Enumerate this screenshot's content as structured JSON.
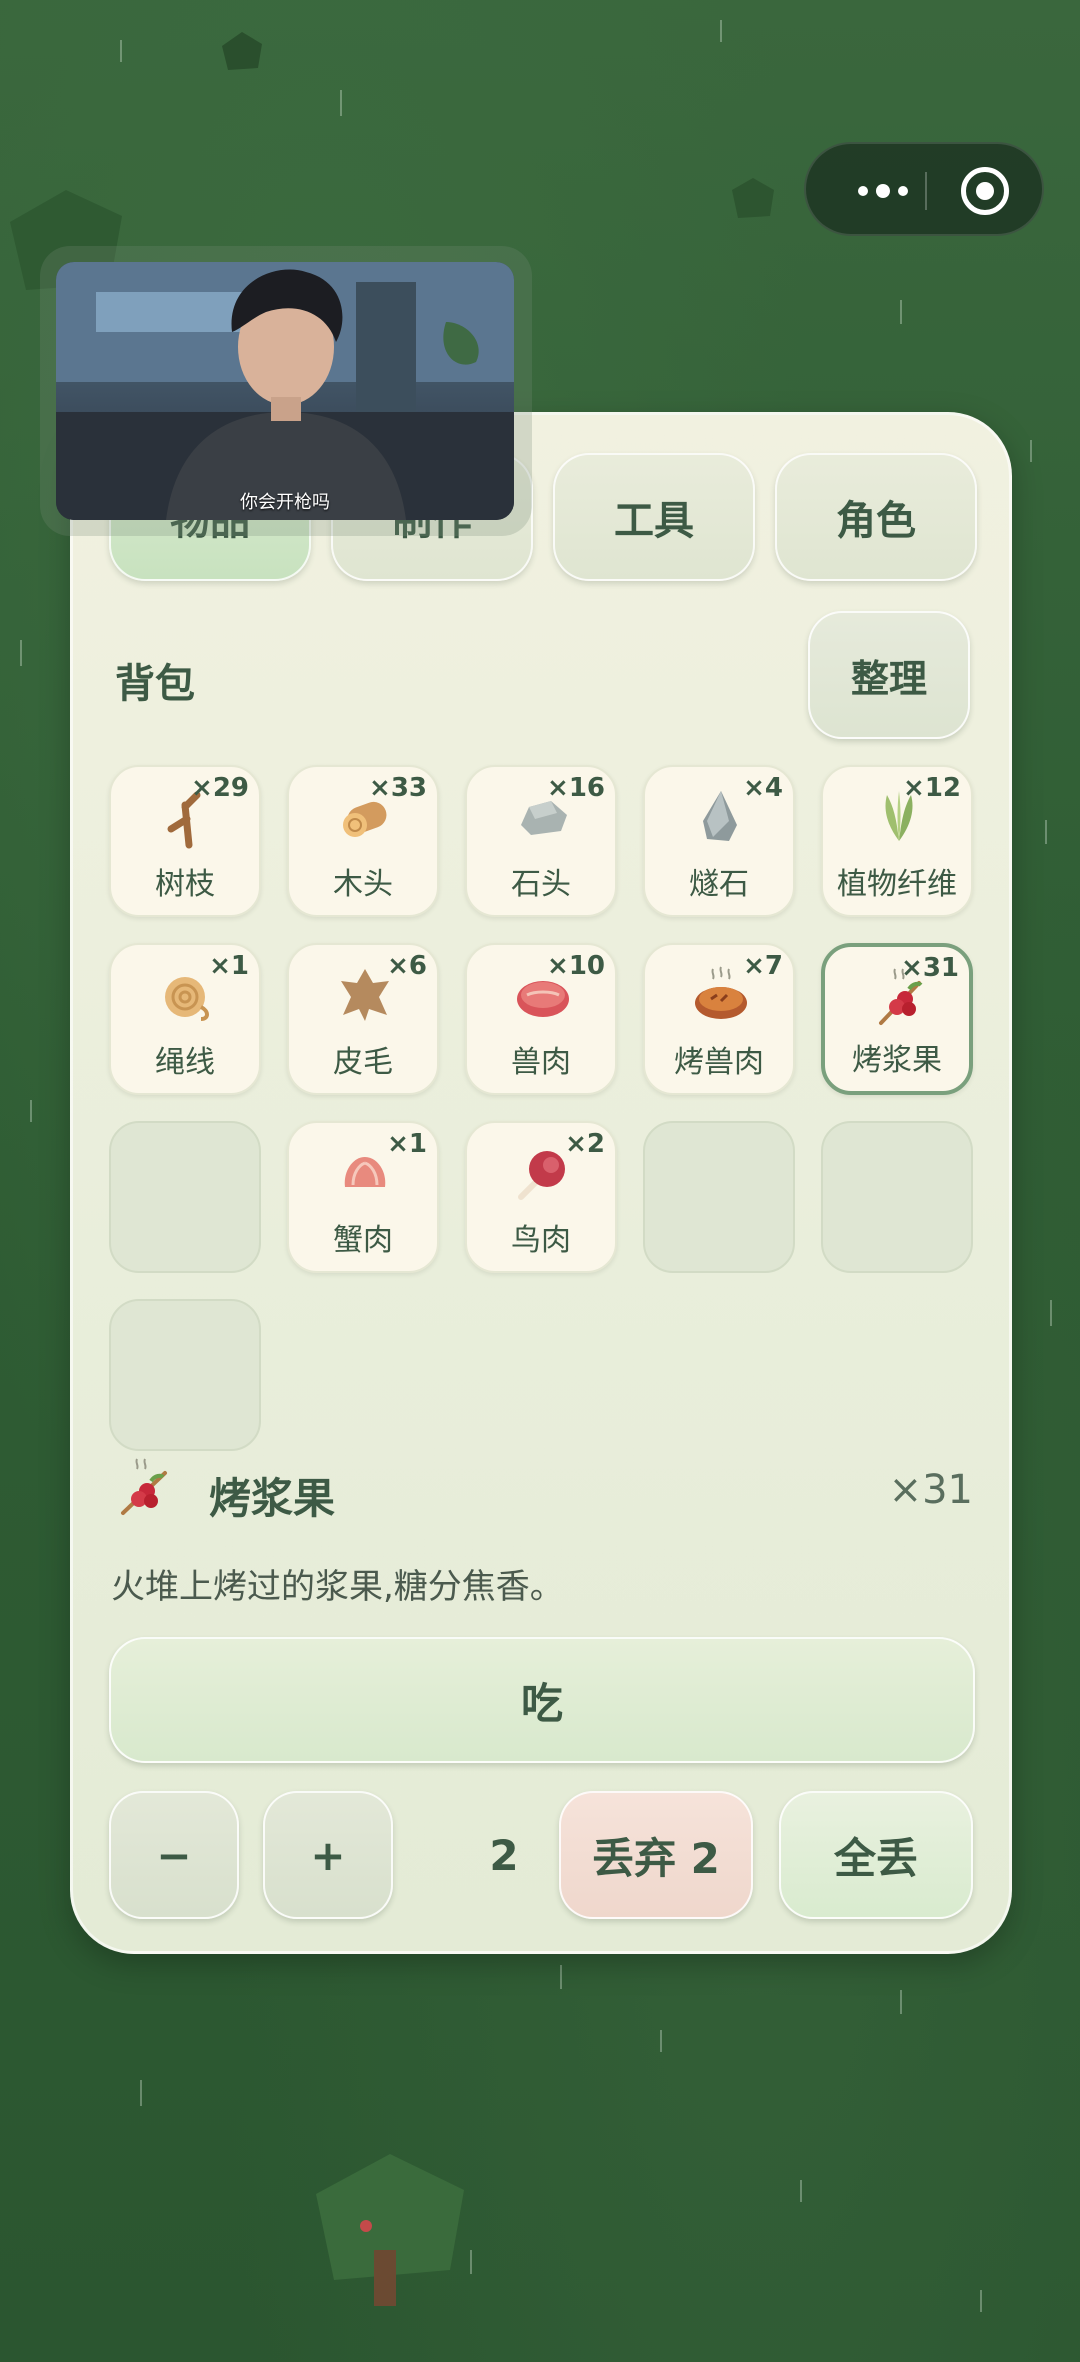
{
  "tabs": [
    {
      "label": "物品",
      "active": true
    },
    {
      "label": "制作",
      "active": false
    },
    {
      "label": "工具",
      "active": false
    },
    {
      "label": "角色",
      "active": false
    }
  ],
  "inventory": {
    "title": "背包",
    "sort_label": "整理",
    "slots": [
      {
        "name": "树枝",
        "count": "×29",
        "icon": "branch-icon"
      },
      {
        "name": "木头",
        "count": "×33",
        "icon": "log-icon"
      },
      {
        "name": "石头",
        "count": "×16",
        "icon": "stone-icon"
      },
      {
        "name": "燧石",
        "count": "×4",
        "icon": "flint-icon"
      },
      {
        "name": "植物纤维",
        "count": "×12",
        "icon": "plant-fiber-icon"
      },
      {
        "name": "绳线",
        "count": "×1",
        "icon": "rope-icon"
      },
      {
        "name": "皮毛",
        "count": "×6",
        "icon": "fur-icon"
      },
      {
        "name": "兽肉",
        "count": "×10",
        "icon": "raw-meat-icon"
      },
      {
        "name": "烤兽肉",
        "count": "×7",
        "icon": "cooked-meat-icon"
      },
      {
        "name": "烤浆果",
        "count": "×31",
        "icon": "roasted-berries-icon",
        "selected": true
      },
      {
        "name": "",
        "count": "",
        "empty": true
      },
      {
        "name": "蟹肉",
        "count": "×1",
        "icon": "crab-meat-icon"
      },
      {
        "name": "鸟肉",
        "count": "×2",
        "icon": "bird-meat-icon"
      },
      {
        "name": "",
        "count": "",
        "empty": true
      },
      {
        "name": "",
        "count": "",
        "empty": true
      },
      {
        "name": "",
        "count": "",
        "empty": true
      }
    ]
  },
  "detail": {
    "name": "烤浆果",
    "count": "×31",
    "description": "火堆上烤过的浆果,糖分焦香。",
    "icon": "roasted-berries-icon"
  },
  "actions": {
    "eat_label": "吃",
    "minus_label": "−",
    "plus_label": "+",
    "quantity": "2",
    "discard_label": "丢弃 2",
    "discard_all_label": "全丢"
  },
  "video": {
    "caption": "你会开枪吗"
  },
  "colors": {
    "accent": "#3d5a45",
    "selected_border": "#7aa07d",
    "background": "#2f5a33"
  }
}
